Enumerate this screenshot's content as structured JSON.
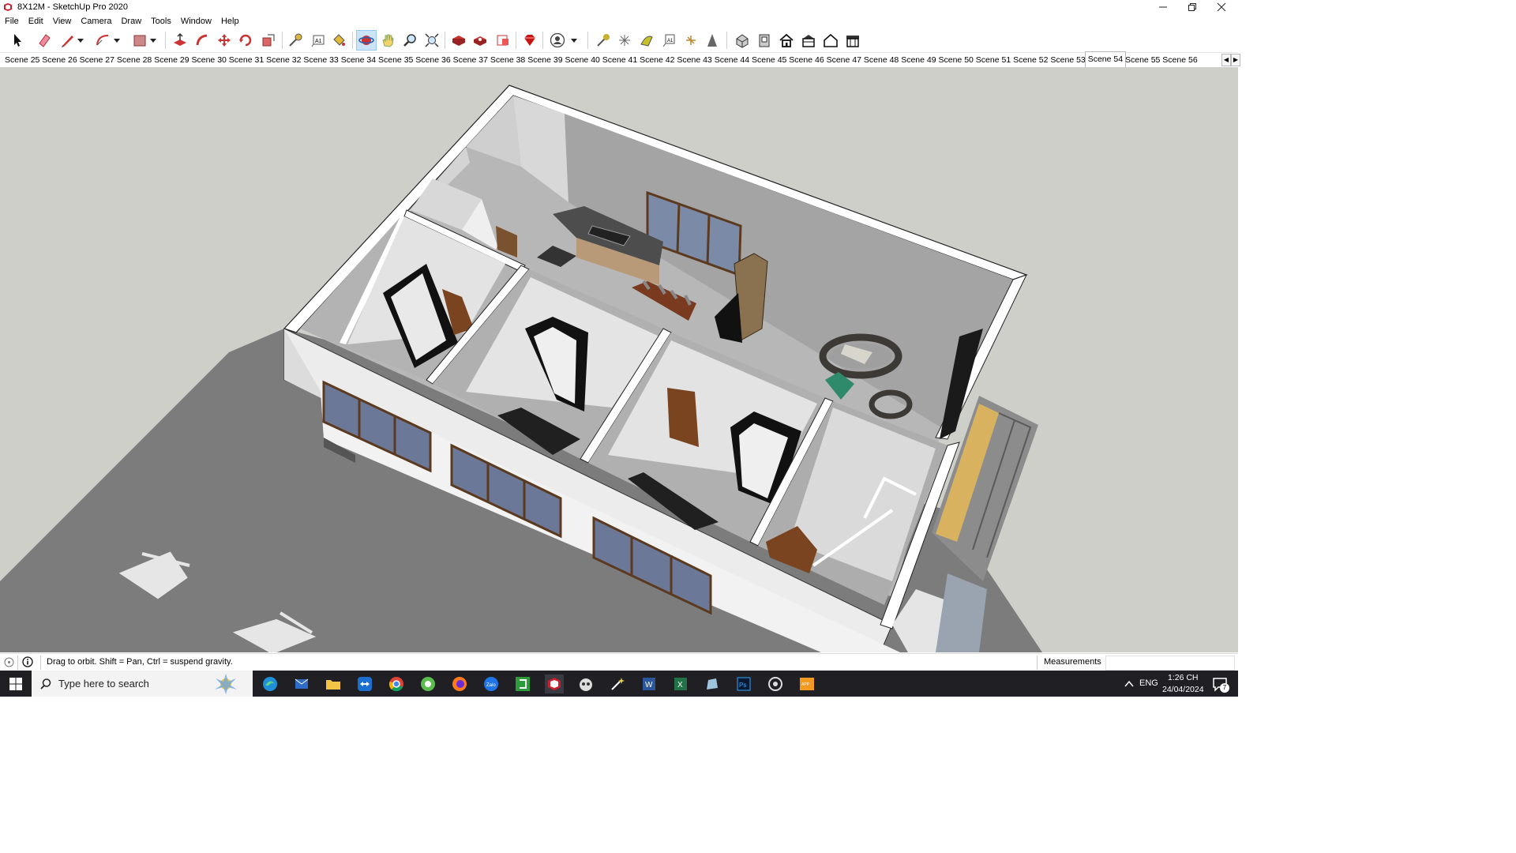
{
  "window": {
    "title": "8X12M - SketchUp Pro 2020",
    "controls": [
      "minimize",
      "restore",
      "close"
    ]
  },
  "menu": [
    "File",
    "Edit",
    "View",
    "Camera",
    "Draw",
    "Tools",
    "Window",
    "Help"
  ],
  "scenes": {
    "items": [
      "Scene 25",
      "Scene 26",
      "Scene 27",
      "Scene 28",
      "Scene 29",
      "Scene 30",
      "Scene 31",
      "Scene 32",
      "Scene 33",
      "Scene 34",
      "Scene 35",
      "Scene 36",
      "Scene 37",
      "Scene 38",
      "Scene 39",
      "Scene 40",
      "Scene 41",
      "Scene 42",
      "Scene 43",
      "Scene 44",
      "Scene 45",
      "Scene 46",
      "Scene 47",
      "Scene 48",
      "Scene 49",
      "Scene 50",
      "Scene 51",
      "Scene 52",
      "Scene 53",
      "Scene 54",
      "Scene 55",
      "Scene 56"
    ],
    "selected": "Scene 54"
  },
  "toolbar": {
    "tools": [
      "select-icon",
      "eraser-icon",
      "pencil-line-icon",
      "arc-icon",
      "rectangle-icon",
      "push-pull-icon",
      "follow-me-icon",
      "move-icon",
      "rotate-icon",
      "scale-icon",
      "tape-measure-icon",
      "text-icon",
      "paint-bucket-icon",
      "orbit-icon",
      "pan-icon",
      "zoom-icon",
      "zoom-extents-icon",
      "warehouse-icon",
      "extension-warehouse-icon",
      "layout-icon",
      "ruby-icon",
      "user-icon",
      "sandbox-icon",
      "sandbox-grid-icon",
      "smoove-icon",
      "stamp-icon",
      "drape-icon",
      "add-detail-icon",
      "flip-edge-icon",
      "iso-view-icon",
      "front-view-icon",
      "home-icon",
      "right-view-icon",
      "top-view-icon",
      "back-view-icon"
    ],
    "active_tool": "orbit-icon"
  },
  "status": {
    "message": "Drag to orbit. Shift = Pan, Ctrl = suspend gravity.",
    "measurements_label": "Measurements",
    "measurements_value": ""
  },
  "taskbar": {
    "search_placeholder": "Type here to search",
    "apps": [
      "edge-icon",
      "outlook-icon",
      "file-explorer-icon",
      "teamviewer-icon",
      "chrome-icon",
      "coccoc-icon",
      "firefox-icon",
      "zalo-icon",
      "camtasia-icon",
      "sketchup-icon",
      "vmware-icon",
      "magic-icon",
      "word-icon",
      "excel-icon",
      "pen-icon",
      "photoshop-icon",
      "obs-icon",
      "zalo-pc-icon"
    ],
    "language": "ENG",
    "time": "1:26 CH",
    "date": "24/04/2024",
    "notification_count": "7"
  },
  "colors": {
    "viewport_bg": "#cfcfca",
    "ground_shadow": "#7e7e7e",
    "wall": "#ececec",
    "floor": "#b4b4b4",
    "taskbar": "#1f1f24",
    "active_tool": "#cce4f7"
  }
}
